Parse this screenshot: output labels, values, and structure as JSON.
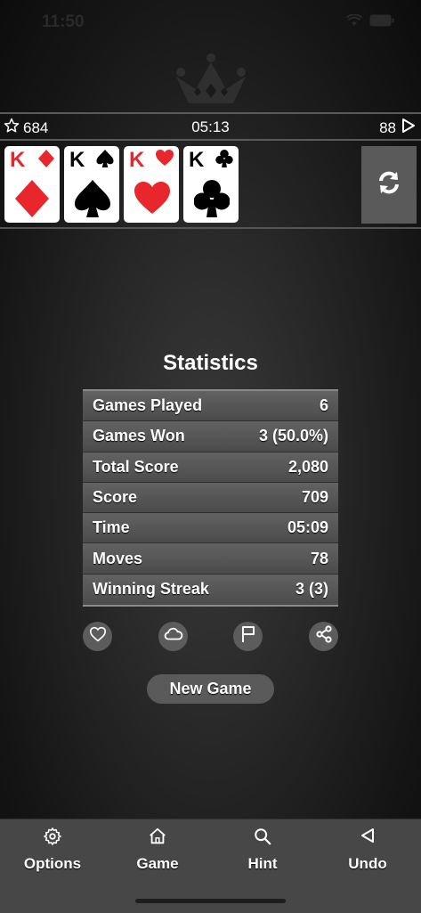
{
  "status_bar": {
    "time": "11:50"
  },
  "info_bar": {
    "score_value": "684",
    "timer": "05:13",
    "moves_value": "88"
  },
  "foundation": {
    "cards": [
      {
        "rank": "K",
        "suit": "diamonds",
        "color": "red"
      },
      {
        "rank": "K",
        "suit": "spades",
        "color": "black"
      },
      {
        "rank": "K",
        "suit": "hearts",
        "color": "red"
      },
      {
        "rank": "K",
        "suit": "clubs",
        "color": "black"
      }
    ],
    "refresh_icon": "refresh-icon"
  },
  "statistics": {
    "title": "Statistics",
    "rows": [
      {
        "label": "Games Played",
        "value": "6"
      },
      {
        "label": "Games Won",
        "value": "3 (50.0%)"
      },
      {
        "label": "Total Score",
        "value": "2,080"
      },
      {
        "label": "Score",
        "value": "709"
      },
      {
        "label": "Time",
        "value": "05:09"
      },
      {
        "label": "Moves",
        "value": "78"
      },
      {
        "label": "Winning Streak",
        "value": "3 (3)"
      }
    ]
  },
  "actions": {
    "icons": [
      "heart-icon",
      "cloud-icon",
      "flag-icon",
      "share-icon"
    ]
  },
  "new_game_label": "New Game",
  "toolbar": {
    "options_label": "Options",
    "game_label": "Game",
    "hint_label": "Hint",
    "undo_label": "Undo"
  },
  "colors": {
    "red_suit": "#e8262b",
    "panel": "#5a5a5a",
    "toolbar": "#474747"
  }
}
